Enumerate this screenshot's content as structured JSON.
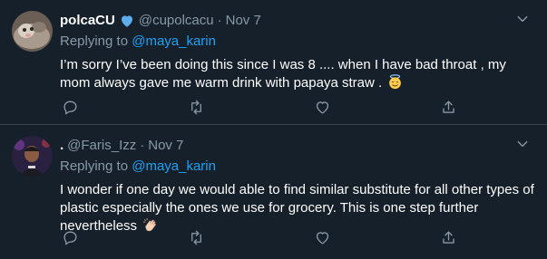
{
  "tweets": [
    {
      "author_name": "polcaCU",
      "verified_icon": "blue-heart-icon",
      "handle": "@cupolcacu",
      "separator": "·",
      "date": "Nov 7",
      "replying_to_label": "Replying to",
      "replying_to_handle": "@maya_karin",
      "text": "I’m sorry I’ve been doing this since I was 8 .... when I have bad throat , my mom always gave me warm drink with papaya straw .",
      "trailing_emoji": "halo-smile-emoji-icon"
    },
    {
      "author_name": ".",
      "handle": "@Faris_Izz",
      "separator": "·",
      "date": "Nov 7",
      "replying_to_label": "Replying to",
      "replying_to_handle": "@maya_karin",
      "text": "I wonder if one day we would able to find similar substitute for all other types of plastic especially the ones we use for grocery. This is one step further nevertheless",
      "trailing_emoji": "clapping-hands-emoji-icon"
    }
  ],
  "action_icons": [
    "reply-icon",
    "retweet-icon",
    "like-icon",
    "share-icon"
  ],
  "colors": {
    "background": "#15202b",
    "divider": "#38444d",
    "secondary_text": "#8899a6",
    "accent": "#1da1f2",
    "text": "#ffffff"
  }
}
